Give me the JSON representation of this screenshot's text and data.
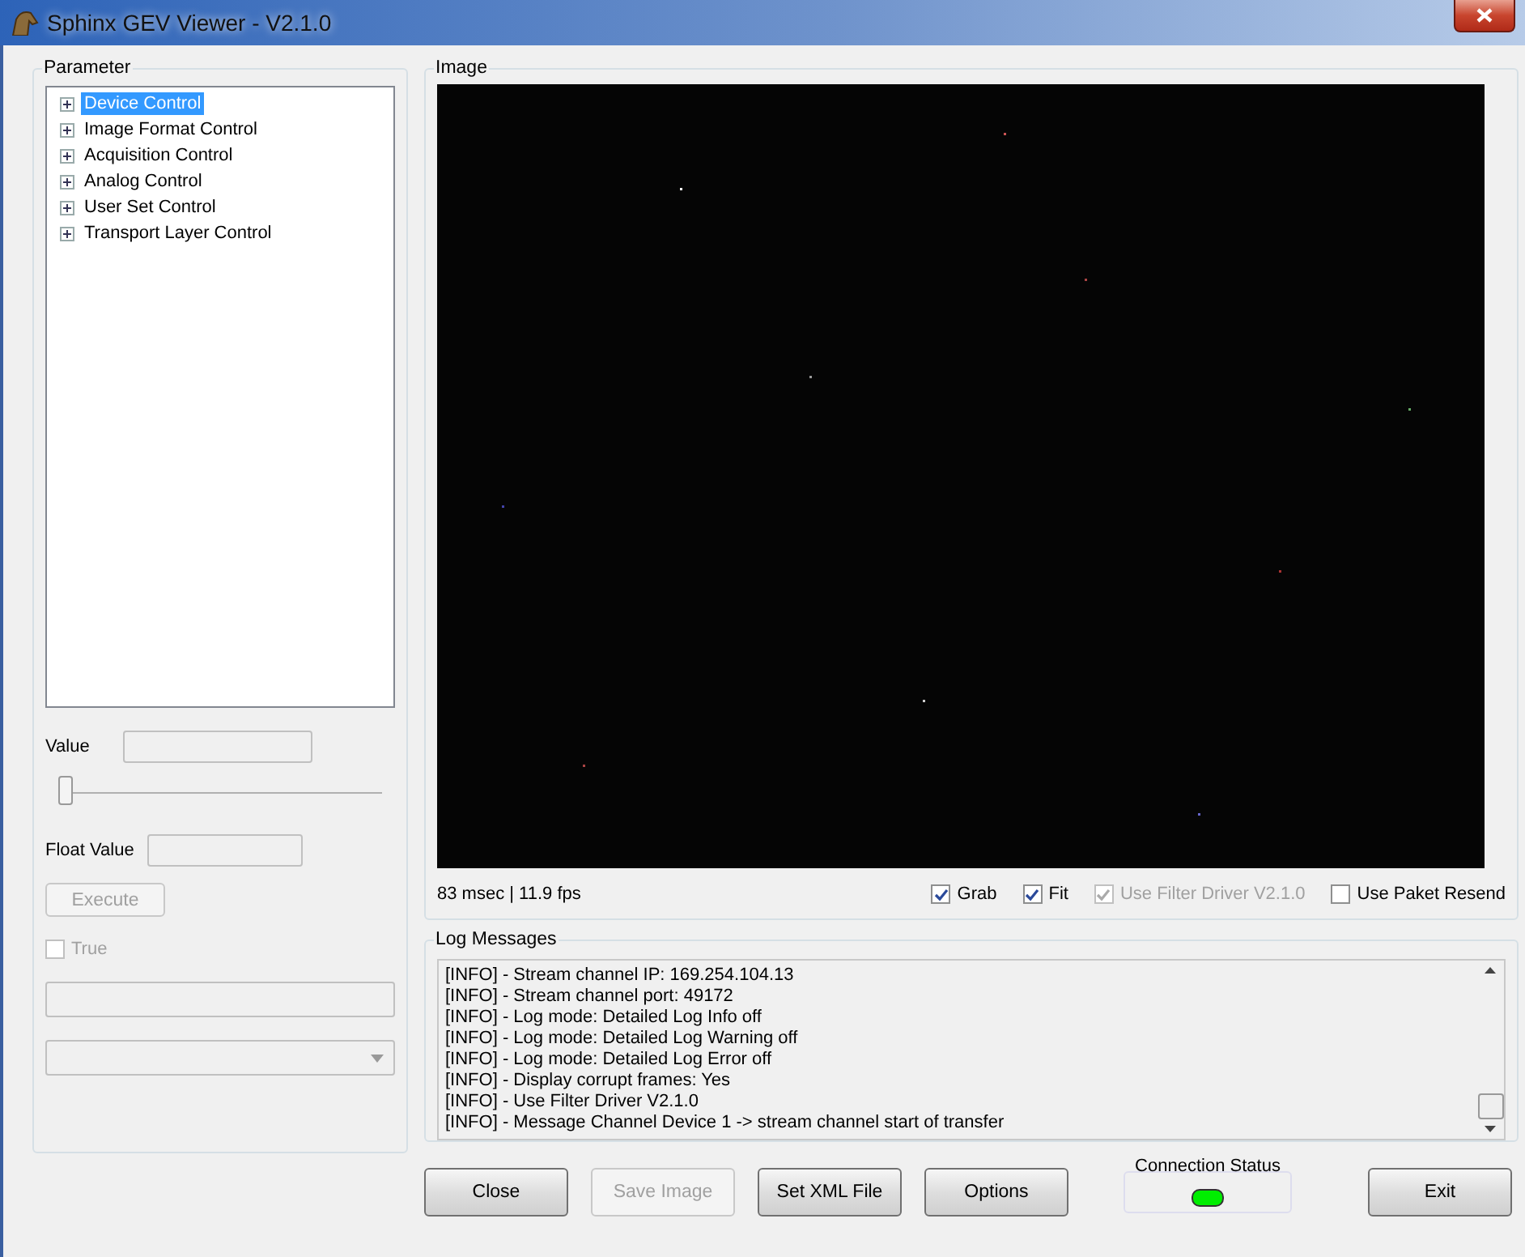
{
  "window": {
    "title": "Sphinx GEV Viewer - V2.1.0"
  },
  "parameter": {
    "title": "Parameter",
    "tree": [
      {
        "label": "Device Control",
        "selected": true,
        "expanded": false
      },
      {
        "label": "Image Format Control",
        "selected": false,
        "expanded": false
      },
      {
        "label": "Acquisition Control",
        "selected": false,
        "expanded": false
      },
      {
        "label": "Analog Control",
        "selected": false,
        "expanded": false
      },
      {
        "label": "User Set Control",
        "selected": false,
        "expanded": false
      },
      {
        "label": "Transport Layer Control",
        "selected": false,
        "expanded": false
      }
    ],
    "value_label": "Value",
    "slider": {
      "level": 0
    },
    "float_value_label": "Float Value",
    "execute": {
      "label": "Execute",
      "disabled": true
    },
    "true_checkbox": {
      "label": "True",
      "checked": false,
      "disabled": true
    }
  },
  "image": {
    "title": "Image",
    "kind": "picture",
    "timing": "83 msec | 11.9 fps",
    "options": [
      {
        "label": "Grab",
        "checked": true,
        "disabled": false
      },
      {
        "label": "Fit",
        "checked": true,
        "disabled": false
      },
      {
        "label": "Use Filter Driver V2.1.0",
        "checked": true,
        "disabled": true
      },
      {
        "label": "Use Paket Resend",
        "checked": false,
        "disabled": false
      }
    ]
  },
  "log": {
    "title": "Log Messages",
    "lines": [
      "[INFO] - Stream channel IP: 169.254.104.13",
      "[INFO] - Stream channel port: 49172",
      "[INFO] - Log mode: Detailed Log Info off",
      "[INFO] - Log mode: Detailed Log Warning off",
      "[INFO] - Log mode: Detailed Log Error off",
      "[INFO] - Display corrupt frames: Yes",
      "[INFO] - Use Filter Driver V2.1.0",
      "[INFO] - Message Channel Device 1 -> stream channel start of transfer"
    ]
  },
  "buttons": [
    {
      "label": "Close",
      "disabled": false
    },
    {
      "label": "Save Image",
      "disabled": true
    },
    {
      "label": "Set XML File",
      "disabled": false
    },
    {
      "label": "Options",
      "disabled": false
    }
  ],
  "connection_status": {
    "label": "Connection Status",
    "connected": true
  },
  "exit_button": {
    "label": "Exit",
    "disabled": false
  }
}
